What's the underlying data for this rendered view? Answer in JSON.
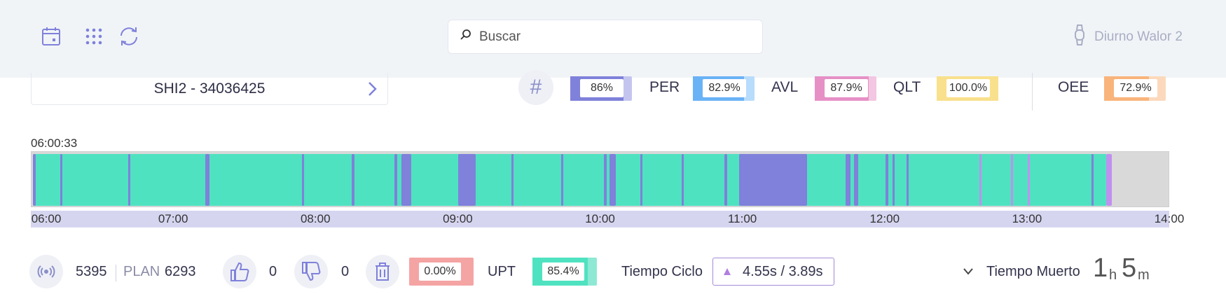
{
  "header": {
    "search_placeholder": "Buscar",
    "user_name": "Diurno Walor 2",
    "icons": [
      "calendar-icon",
      "apps-grid-icon",
      "refresh-icon",
      "search-icon",
      "watch-icon"
    ]
  },
  "order": {
    "label": "SHI2 - 34036425"
  },
  "metrics": {
    "hash_value": "86%",
    "per_label": "PER",
    "per_value": "82.9%",
    "avl_label": "AVL",
    "avl_value": "87.9%",
    "qlt_label": "QLT",
    "qlt_value": "100.0%",
    "oee_label": "OEE",
    "oee_value": "72.9%",
    "colors": {
      "hash": "#7f81da",
      "per": "#6ab2f6",
      "avl": "#e690c6",
      "qlt": "#f9e08c",
      "oee": "#f9b47b"
    }
  },
  "timeline": {
    "start_label": "06:00:33",
    "ticks": [
      "06:00",
      "07:00",
      "08:00",
      "09:00",
      "10:00",
      "11:00",
      "12:00",
      "13:00",
      "14:00"
    ],
    "colors": {
      "running": "#4fe2c0",
      "stop": "#7f81da",
      "other": "#c090ee",
      "idle": "#d9d9d9"
    }
  },
  "bottom": {
    "produced": "5395",
    "plan_label": "PLAN",
    "plan_value": "6293",
    "good_count": "0",
    "bad_count": "0",
    "scrap_rate": "0.00%",
    "upt_label": "UPT",
    "upt_value": "85.4%",
    "cycle_label": "Tiempo Ciclo",
    "cycle_value": "4.55s / 3.89s",
    "dead_label": "Tiempo Muerto",
    "dead_hours": "1",
    "dead_hours_unit": "h",
    "dead_minutes": "5",
    "dead_minutes_unit": "m"
  }
}
